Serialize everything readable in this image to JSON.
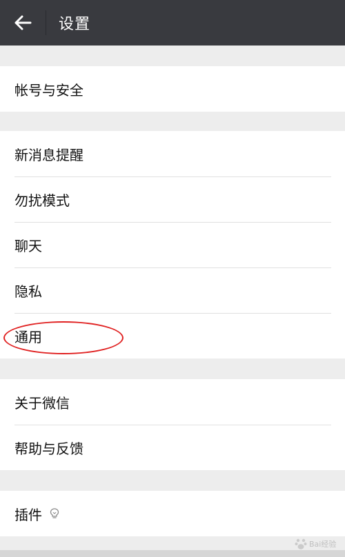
{
  "header": {
    "title": "设置",
    "back_icon": "arrow-left-icon"
  },
  "groups": [
    {
      "items": [
        {
          "label": "帐号与安全"
        }
      ]
    },
    {
      "items": [
        {
          "label": "新消息提醒"
        },
        {
          "label": "勿扰模式"
        },
        {
          "label": "聊天"
        },
        {
          "label": "隐私"
        },
        {
          "label": "通用",
          "highlighted": true
        }
      ]
    },
    {
      "items": [
        {
          "label": "关于微信"
        },
        {
          "label": "帮助与反馈"
        }
      ]
    },
    {
      "items": [
        {
          "label": "插件",
          "icon": "lightbulb-icon"
        }
      ]
    }
  ],
  "annotation": {
    "color": "#e02020",
    "shape": "ellipse",
    "target": "通用"
  },
  "watermark": {
    "text": "Bai经验"
  },
  "colors": {
    "header_bg": "#393a3f",
    "page_bg": "#ededed",
    "row_bg": "#ffffff",
    "separator": "#e0e0e0"
  }
}
